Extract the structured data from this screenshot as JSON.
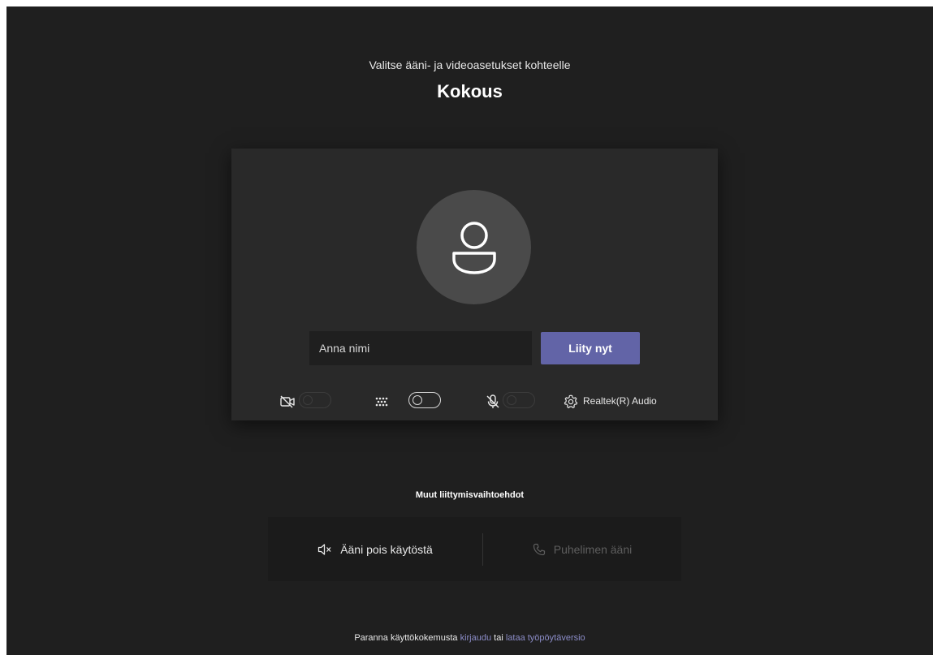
{
  "header": {
    "subtitle": "Valitse ääni- ja videoasetukset kohteelle",
    "meeting_title": "Kokous"
  },
  "prejoin": {
    "avatar_icon": "person-icon",
    "name_input": {
      "value": "",
      "placeholder": "Anna nimi"
    },
    "join_button_label": "Liity nyt",
    "controls": {
      "camera_icon": "camera-off-icon",
      "camera_toggle": "off-disabled",
      "background_icon": "background-blur-icon",
      "background_toggle": "off",
      "mic_icon": "mic-off-icon",
      "mic_toggle": "off-disabled",
      "settings_icon": "gear-icon",
      "device_label": "Realtek(R) Audio"
    }
  },
  "other_options": {
    "title": "Muut liittymisvaihtoehdot",
    "audio_off": {
      "icon": "speaker-mute-icon",
      "label": "Ääni pois käytöstä"
    },
    "phone_audio": {
      "icon": "phone-icon",
      "label": "Puhelimen ääni"
    }
  },
  "footer": {
    "prefix": "Paranna käyttökokemusta ",
    "signin_link": "kirjaudu",
    "middle": " tai ",
    "download_link": "lataa työpöytäversio"
  },
  "colors": {
    "background": "#1f1f1f",
    "card": "#292929",
    "accent": "#6264a7",
    "link": "#8b8cc7"
  }
}
